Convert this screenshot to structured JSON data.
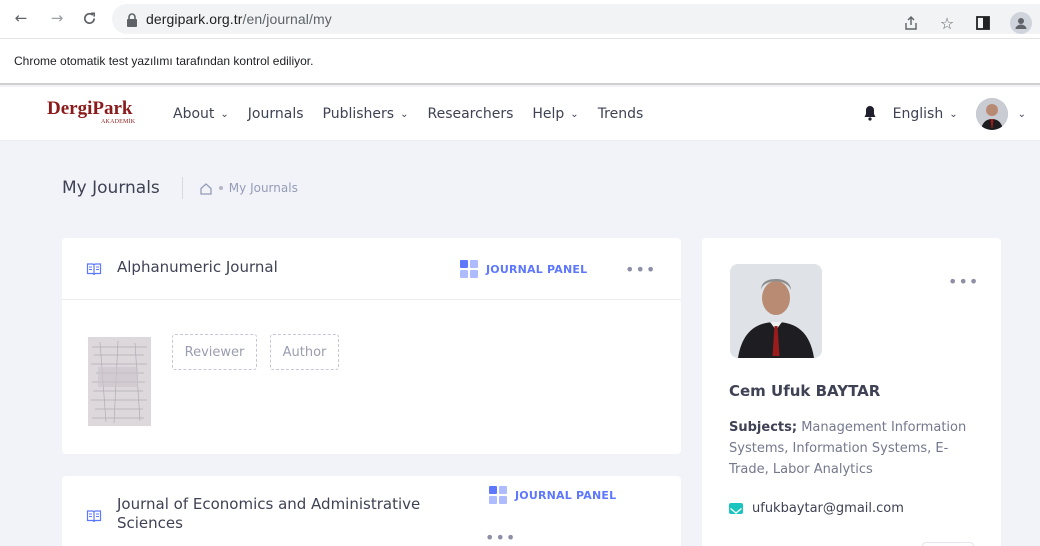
{
  "browser": {
    "url_host": "dergipark.org.tr",
    "url_path": "/en/journal/my",
    "infobar_text": "Chrome otomatik test yazılımı tarafından kontrol ediliyor."
  },
  "header": {
    "logo_brand": "DergiPark",
    "logo_sub": "AKADEMİK",
    "menu": [
      {
        "label": "About",
        "caret": true
      },
      {
        "label": "Journals",
        "caret": false
      },
      {
        "label": "Publishers",
        "caret": true
      },
      {
        "label": "Researchers",
        "caret": false
      },
      {
        "label": "Help",
        "caret": true
      },
      {
        "label": "Trends",
        "caret": false
      }
    ],
    "language": "English"
  },
  "subheader": {
    "title": "My Journals",
    "breadcrumb": "My Journals"
  },
  "journals": [
    {
      "title": "Alphanumeric Journal",
      "panel_label": "JOURNAL PANEL",
      "roles": [
        "Reviewer",
        "Author"
      ]
    },
    {
      "title": "Journal of Economics and Administrative Sciences",
      "panel_label": "JOURNAL PANEL"
    }
  ],
  "profile": {
    "name": "Cem Ufuk BAYTAR",
    "subjects_label": "Subjects;",
    "subjects": " Management Information Systems, Information Systems, E-Trade, Labor Analytics",
    "email": "ufukbaytar@gmail.com"
  },
  "colors": {
    "accent": "#5d78ff",
    "brand": "#8b1a1a",
    "mail": "#1bc5bd",
    "background": "#f2f3f8"
  }
}
